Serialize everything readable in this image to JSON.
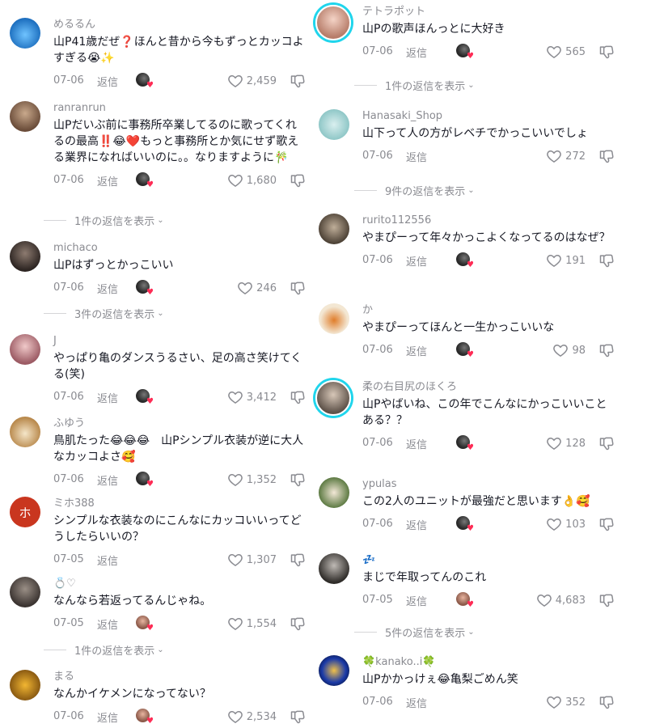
{
  "ui": {
    "reply_label": "返信",
    "accent_color": "#fe2c55",
    "story_ring_color": "#20d5ec"
  },
  "left": {
    "comments": [
      {
        "username": "めるるん",
        "text": "山P41歳だぜ❓ほんと昔から今もずっとカッコよすぎる😭✨",
        "date": "07-06",
        "likes": "2,459",
        "avatar_icon": "user-avatar"
      },
      {
        "username": "ranranrun",
        "text": "山Pだいぶ前に事務所卒業してるのに歌ってくれるの最高‼️😂❤️もっと事務所とか気にせず歌える業界になればいいのに。。なりますように🎋",
        "date": "07-06",
        "likes": "1,680",
        "avatar_icon": "user-avatar"
      },
      {
        "username": "michaco",
        "text": "山Pはずっとかっこいい",
        "date": "07-06",
        "likes": "246",
        "avatar_icon": "user-avatar"
      },
      {
        "username": "J",
        "text": "やっぱり亀のダンスうるさい、足の高さ笑けてくる(笑)",
        "date": "07-06",
        "likes": "3,412",
        "avatar_icon": "user-avatar"
      },
      {
        "username": "ふゆう",
        "text": "鳥肌たった😂😂😂　山Pシンプル衣装が逆に大人なカッコよさ🥰",
        "date": "07-06",
        "likes": "1,352",
        "avatar_icon": "user-avatar"
      },
      {
        "username": "ミホ388",
        "text": "シンプルな衣装なのにこんなにカッコいいってどうしたらいいの？",
        "date": "07-05",
        "likes": "1,307",
        "avatar_letter": "ホ"
      },
      {
        "username": "💍♡",
        "text": "なんなら若返ってるんじゃね。",
        "date": "07-05",
        "likes": "1,554",
        "avatar_icon": "user-avatar"
      },
      {
        "username": "まる",
        "text": "なんかイケメンになってない？",
        "date": "07-06",
        "likes": "2,534",
        "avatar_icon": "user-avatar"
      }
    ],
    "replies": [
      {
        "label": "1件の返信を表示"
      },
      {
        "label": "3件の返信を表示"
      },
      {
        "label": "1件の返信を表示"
      }
    ]
  },
  "right": {
    "comments": [
      {
        "username": "テトラポット",
        "text": "山Pの歌声ほんっとに大好き",
        "date": "07-06",
        "likes": "565",
        "avatar_icon": "user-avatar"
      },
      {
        "username": "Hanasaki_Shop",
        "text": "山下って人の方がレベチでかっこいいでしょ",
        "date": "07-06",
        "likes": "272",
        "avatar_icon": "user-avatar"
      },
      {
        "username": "rurito112556",
        "text": "やまぴーって年々かっこよくなってるのはなぜ？",
        "date": "07-06",
        "likes": "191",
        "avatar_icon": "user-avatar"
      },
      {
        "username": "か",
        "text": "やまぴーってほんと一生かっこいいな",
        "date": "07-06",
        "likes": "98",
        "avatar_icon": "user-avatar"
      },
      {
        "username": "柔の右目尻のほくろ",
        "text": "山Pやばいね、この年でこんなにかっこいいことある？？",
        "date": "07-06",
        "likes": "128",
        "avatar_icon": "user-avatar"
      },
      {
        "username": "ypulas",
        "text": "この2人のユニットが最強だと思います👌🥰",
        "date": "07-06",
        "likes": "103",
        "avatar_icon": "user-avatar"
      },
      {
        "username": "💤",
        "text": "まじで年取ってんのこれ",
        "date": "07-05",
        "likes": "4,683",
        "avatar_icon": "user-avatar"
      },
      {
        "username": "🍀kanako..i🍀",
        "text": "山Pかかっけぇ😂亀梨ごめん笑",
        "date": "07-06",
        "likes": "352",
        "avatar_icon": "user-avatar"
      }
    ],
    "replies": [
      {
        "label": "1件の返信を表示"
      },
      {
        "label": "9件の返信を表示"
      },
      {
        "label": "5件の返信を表示"
      }
    ]
  }
}
